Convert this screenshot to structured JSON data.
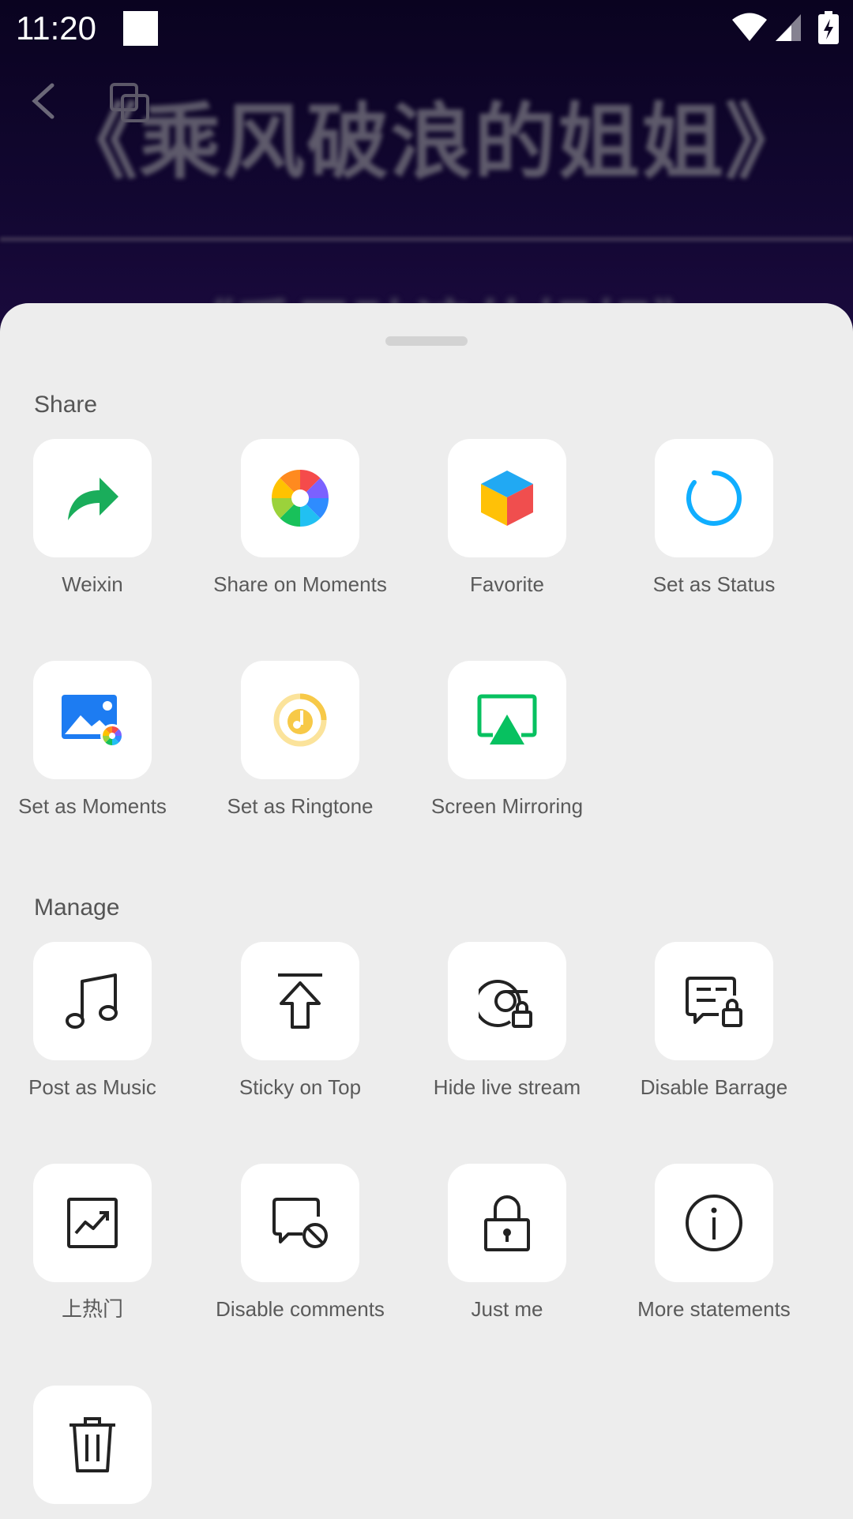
{
  "status_bar": {
    "time": "11:20"
  },
  "background": {
    "title": "《乘风破浪的姐姐》",
    "subtitle": "《乘风破浪的姐姐》"
  },
  "sections": {
    "share_title": "Share",
    "manage_title": "Manage"
  },
  "share_items": [
    {
      "label": "Weixin",
      "icon": "share-arrow-icon"
    },
    {
      "label": "Share on Moments",
      "icon": "moments-shutter-icon"
    },
    {
      "label": "Favorite",
      "icon": "favorite-cube-icon"
    },
    {
      "label": "Set as Status",
      "icon": "status-ring-icon"
    },
    {
      "label": "Set as Moments",
      "icon": "image-moments-icon"
    },
    {
      "label": "Set as Ringtone",
      "icon": "ringtone-icon"
    },
    {
      "label": "Screen Mirroring",
      "icon": "screen-mirroring-icon"
    }
  ],
  "manage_items": [
    {
      "label": "Post as Music",
      "icon": "music-note-icon"
    },
    {
      "label": "Sticky on Top",
      "icon": "sticky-top-icon"
    },
    {
      "label": "Hide live stream",
      "icon": "hide-live-icon"
    },
    {
      "label": "Disable Barrage",
      "icon": "disable-barrage-icon"
    },
    {
      "label": "上热门",
      "icon": "trending-icon"
    },
    {
      "label": "Disable comments",
      "icon": "disable-comments-icon"
    },
    {
      "label": "Just me",
      "icon": "lock-icon"
    },
    {
      "label": "More statements",
      "icon": "info-icon"
    },
    {
      "label": "",
      "icon": "trash-icon"
    }
  ],
  "colors": {
    "sheet_bg": "#ededed",
    "tile_bg": "#ffffff",
    "weixin_green": "#1aad5b",
    "status_blue": "#10aeff",
    "mirror_green": "#07c160",
    "ringtone_yellow": "#f7c948"
  }
}
